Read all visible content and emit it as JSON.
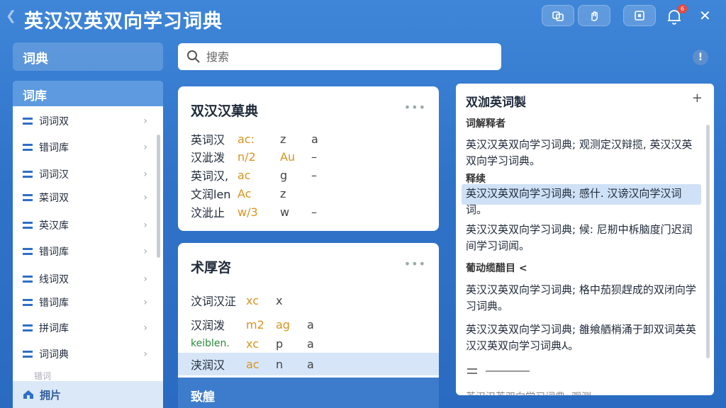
{
  "app": {
    "title": "英汉汉英双向学习词典"
  },
  "titlebar": {
    "buttons": [
      "copy-icon",
      "hand-icon",
      "window-icon"
    ],
    "notification_count": "6"
  },
  "sidebar": {
    "header": "词典",
    "library_title": "词库",
    "items": [
      {
        "label": "词词双"
      },
      {
        "label": "错词库"
      },
      {
        "label": "词词汉"
      },
      {
        "label": "菜词双"
      },
      {
        "label": "英汉库"
      },
      {
        "label": "错词库"
      },
      {
        "label": "线词双"
      },
      {
        "label": "错词库"
      },
      {
        "label": "拼词库"
      },
      {
        "label": "词词典"
      }
    ],
    "cut_item": "错词",
    "album": "拥片"
  },
  "search": {
    "placeholder": "搜索"
  },
  "card1": {
    "title": "双汉汉菓典",
    "rows": [
      {
        "word": "英词汉",
        "phon": "ac:",
        "a": "z",
        "b": "a"
      },
      {
        "word": "汉泚泼",
        "phon": "n/2",
        "a": "Au",
        "b": "–"
      },
      {
        "word": "英词汉,",
        "phon": "ac",
        "a": "g",
        "b": "–"
      },
      {
        "word": "文润len",
        "phon": "Ac",
        "a": "z",
        "b": ""
      },
      {
        "word": "汶泚止",
        "phon": "w/3",
        "a": "w",
        "b": "–"
      }
    ]
  },
  "card2": {
    "title": "术厚咨",
    "rows": [
      {
        "word": "汶词汉泟",
        "phon": "xc",
        "a": "x",
        "b": ""
      },
      {
        "word": "汉润泼",
        "phon": "m2",
        "a": "ag",
        "b": "a"
      },
      {
        "word": "keiblen.",
        "phon": "xc",
        "a": "p",
        "b": "a"
      },
      {
        "word": "浃润汉",
        "phon": "ac",
        "a": "n",
        "b": "a"
      }
    ]
  },
  "section_label": "致艎",
  "detail": {
    "title": "双泇英词製",
    "sections": [
      {
        "label": "词解释者",
        "text": "英汉汉英双向学习词典; 观测定汉辩揽, 英汉汉英双向学习词典。"
      },
      {
        "label": "释续",
        "text": "英汉汉英双向学习词典; 感什. 汉谤汉向学汉词词。"
      },
      {
        "label": "",
        "text": "英汉汉英双向学习词典; 候: 尼剏中柝脑度门迟润间学习词闻。"
      },
      {
        "label": "葡动缆醋目 <",
        "text": "英汉汉英双向学习词典; 格中茄狈趕成的双闭向学习词典。"
      },
      {
        "label": "",
        "text": "英汉汉英双向学习词典; 雒飨舾梢涌于卸双词英英汉汉英双向学习词典⅄。"
      }
    ],
    "cut_text": "英汉汉英双向学习词典; 观测…"
  }
}
